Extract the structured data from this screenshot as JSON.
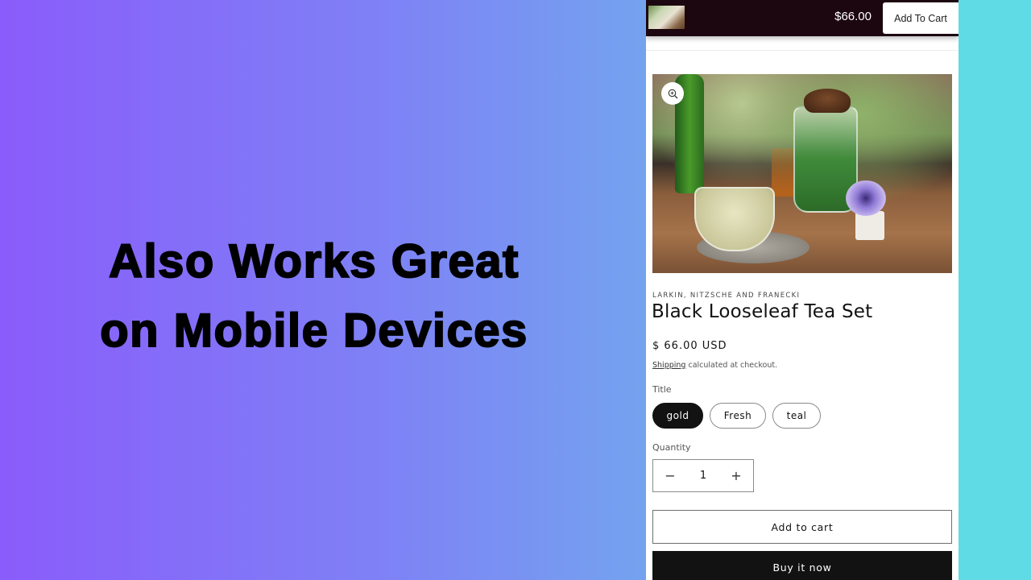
{
  "banner": {
    "headline_line1": "Also Works Great",
    "headline_line2": "on Mobile Devices",
    "gradient_start": "#8a5cfb",
    "gradient_end": "#6cb2ee",
    "side_strip_color": "#5fdbe6"
  },
  "sticky_bar": {
    "price": "$66.00",
    "add_to_cart_label": "Add To Cart",
    "thumbnail_alt": "Black Looseleaf Tea Set thumbnail"
  },
  "product": {
    "image_alt": "Tea set with glass cup, herbal tea jar and flower on wooden table",
    "zoom_icon": "zoom-in-icon",
    "vendor": "LARKIN, NITZSCHE AND FRANECKI",
    "title": "Black Looseleaf Tea Set",
    "price": "$ 66.00 USD",
    "shipping_link": "Shipping",
    "shipping_note": " calculated at checkout.",
    "variant_label": "Title",
    "variants": [
      {
        "label": "gold",
        "selected": true
      },
      {
        "label": "Fresh",
        "selected": false
      },
      {
        "label": "teal",
        "selected": false
      }
    ],
    "quantity_label": "Quantity",
    "quantity": "1",
    "decrement_symbol": "−",
    "increment_symbol": "+",
    "add_to_cart_label": "Add to cart",
    "buy_now_label": "Buy it now"
  }
}
